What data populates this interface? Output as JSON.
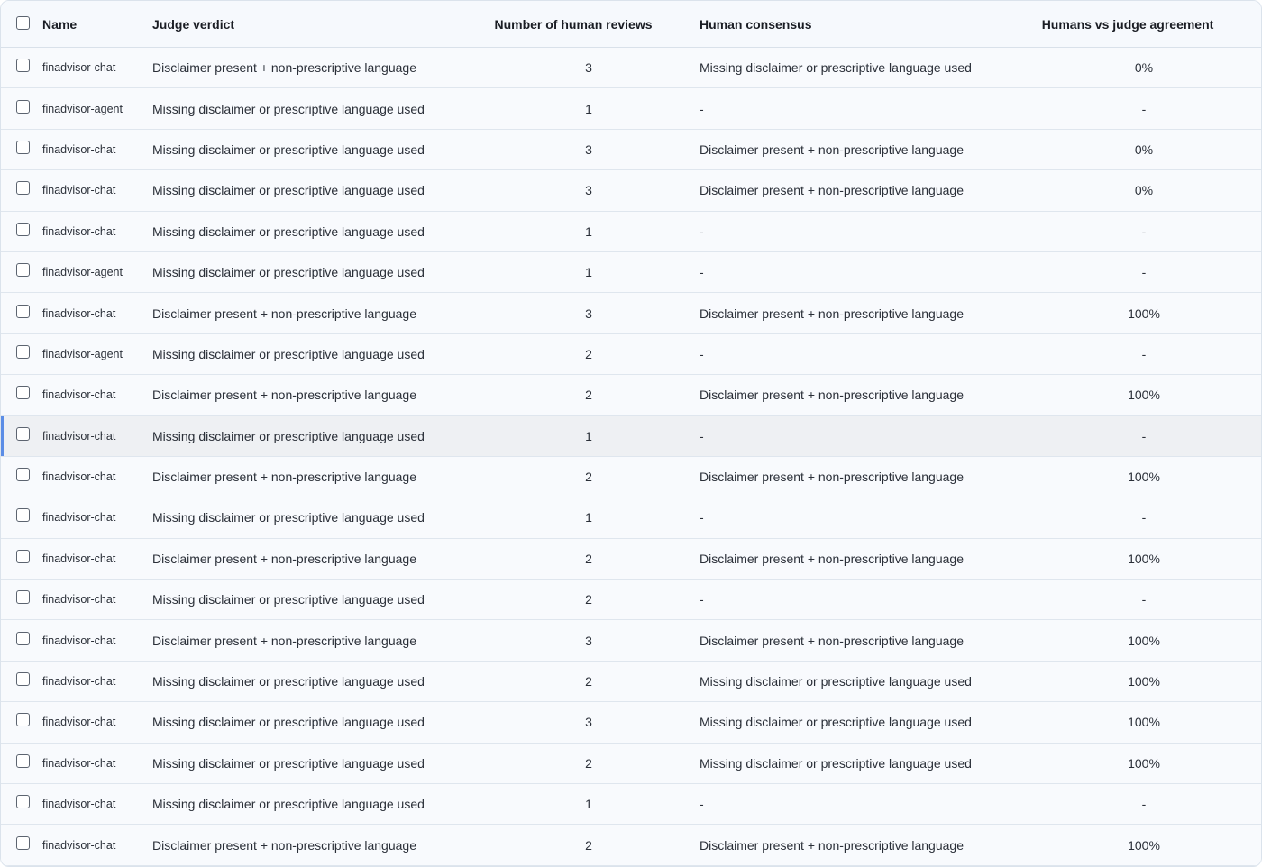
{
  "table": {
    "columns": {
      "name": "Name",
      "verdict": "Judge verdict",
      "reviews": "Number of human reviews",
      "consensus": "Human consensus",
      "agreement": "Humans vs judge agreement"
    },
    "selected_row_index": 9,
    "rows": [
      {
        "name": "finadvisor-chat",
        "verdict": "Disclaimer present + non-prescriptive language",
        "reviews": "3",
        "consensus": "Missing disclaimer or prescriptive language used",
        "agreement": "0%"
      },
      {
        "name": "finadvisor-agent",
        "verdict": "Missing disclaimer or prescriptive language used",
        "reviews": "1",
        "consensus": "-",
        "agreement": "-"
      },
      {
        "name": "finadvisor-chat",
        "verdict": "Missing disclaimer or prescriptive language used",
        "reviews": "3",
        "consensus": "Disclaimer present + non-prescriptive language",
        "agreement": "0%"
      },
      {
        "name": "finadvisor-chat",
        "verdict": "Missing disclaimer or prescriptive language used",
        "reviews": "3",
        "consensus": "Disclaimer present + non-prescriptive language",
        "agreement": "0%"
      },
      {
        "name": "finadvisor-chat",
        "verdict": "Missing disclaimer or prescriptive language used",
        "reviews": "1",
        "consensus": "-",
        "agreement": "-"
      },
      {
        "name": "finadvisor-agent",
        "verdict": "Missing disclaimer or prescriptive language used",
        "reviews": "1",
        "consensus": "-",
        "agreement": "-"
      },
      {
        "name": "finadvisor-chat",
        "verdict": "Disclaimer present + non-prescriptive language",
        "reviews": "3",
        "consensus": "Disclaimer present + non-prescriptive language",
        "agreement": "100%"
      },
      {
        "name": "finadvisor-agent",
        "verdict": "Missing disclaimer or prescriptive language used",
        "reviews": "2",
        "consensus": "-",
        "agreement": "-"
      },
      {
        "name": "finadvisor-chat",
        "verdict": "Disclaimer present + non-prescriptive language",
        "reviews": "2",
        "consensus": "Disclaimer present + non-prescriptive language",
        "agreement": "100%"
      },
      {
        "name": "finadvisor-chat",
        "verdict": "Missing disclaimer or prescriptive language used",
        "reviews": "1",
        "consensus": "-",
        "agreement": "-"
      },
      {
        "name": "finadvisor-chat",
        "verdict": "Disclaimer present + non-prescriptive language",
        "reviews": "2",
        "consensus": "Disclaimer present + non-prescriptive language",
        "agreement": "100%"
      },
      {
        "name": "finadvisor-chat",
        "verdict": "Missing disclaimer or prescriptive language used",
        "reviews": "1",
        "consensus": "-",
        "agreement": "-"
      },
      {
        "name": "finadvisor-chat",
        "verdict": "Disclaimer present + non-prescriptive language",
        "reviews": "2",
        "consensus": "Disclaimer present + non-prescriptive language",
        "agreement": "100%"
      },
      {
        "name": "finadvisor-chat",
        "verdict": "Missing disclaimer or prescriptive language used",
        "reviews": "2",
        "consensus": "-",
        "agreement": "-"
      },
      {
        "name": "finadvisor-chat",
        "verdict": "Disclaimer present + non-prescriptive language",
        "reviews": "3",
        "consensus": "Disclaimer present + non-prescriptive language",
        "agreement": "100%"
      },
      {
        "name": "finadvisor-chat",
        "verdict": "Missing disclaimer or prescriptive language used",
        "reviews": "2",
        "consensus": "Missing disclaimer or prescriptive language used",
        "agreement": "100%"
      },
      {
        "name": "finadvisor-chat",
        "verdict": "Missing disclaimer or prescriptive language used",
        "reviews": "3",
        "consensus": "Missing disclaimer or prescriptive language used",
        "agreement": "100%"
      },
      {
        "name": "finadvisor-chat",
        "verdict": "Missing disclaimer or prescriptive language used",
        "reviews": "2",
        "consensus": "Missing disclaimer or prescriptive language used",
        "agreement": "100%"
      },
      {
        "name": "finadvisor-chat",
        "verdict": "Missing disclaimer or prescriptive language used",
        "reviews": "1",
        "consensus": "-",
        "agreement": "-"
      },
      {
        "name": "finadvisor-chat",
        "verdict": "Disclaimer present + non-prescriptive language",
        "reviews": "2",
        "consensus": "Disclaimer present + non-prescriptive language",
        "agreement": "100%"
      }
    ]
  }
}
